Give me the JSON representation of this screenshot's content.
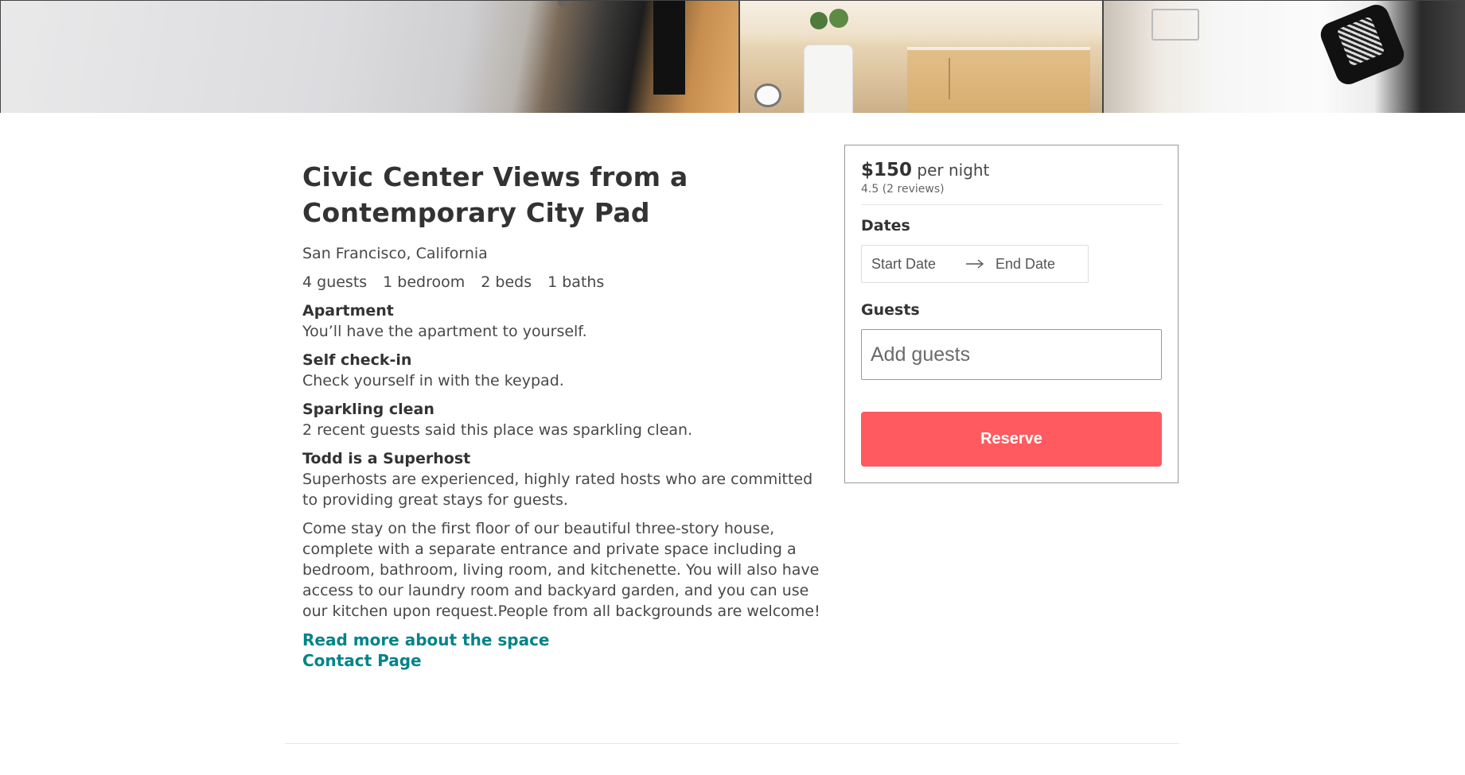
{
  "listing": {
    "title": "Civic Center Views from a Contemporary City Pad",
    "location": "San Francisco, California",
    "specs": [
      "4 guests",
      "1 bedroom",
      "2 beds",
      "1 baths"
    ],
    "features": [
      {
        "title": "Apartment",
        "desc": "You’ll have the apartment to yourself."
      },
      {
        "title": "Self check-in",
        "desc": "Check yourself in with the keypad."
      },
      {
        "title": "Sparkling clean",
        "desc": "2 recent guests said this place was sparkling clean."
      },
      {
        "title": "Todd is a Superhost",
        "desc": "Superhosts are experienced, highly rated hosts who are committed to providing great stays for guests."
      }
    ],
    "description": "Come stay on the first floor of our beautiful three-story house, complete with a separate entrance and private space including a bedroom, bathroom, living room, and kitchenette. You will also have access to our laundry room and backyard garden, and you can use our kitchen upon request.People from all backgrounds are welcome!",
    "links": {
      "read_more": "Read more about the space",
      "contact": "Contact Page"
    }
  },
  "booking": {
    "price": "$150",
    "per_night": "per night",
    "rating": "4.5",
    "reviews": "(2 reviews)",
    "dates_label": "Dates",
    "start_date_placeholder": "Start Date",
    "end_date_placeholder": "End Date",
    "guests_label": "Guests",
    "guests_placeholder": "Add guests",
    "reserve_label": "Reserve"
  },
  "icons": {
    "date_arrow": "right-arrow-icon"
  },
  "colors": {
    "accent_link": "#008489",
    "reserve_button": "#ff5a5f"
  }
}
